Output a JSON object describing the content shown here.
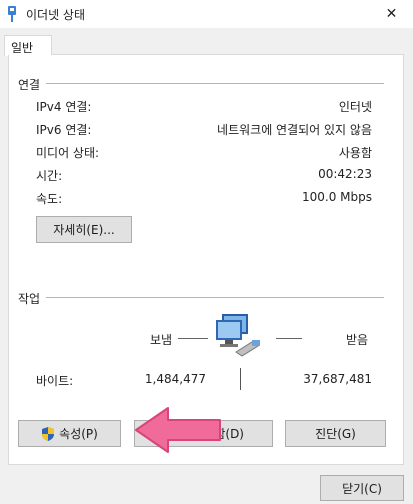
{
  "window": {
    "title": "이더넷 상태",
    "close_glyph": "✕"
  },
  "tabs": [
    {
      "label": "일반"
    }
  ],
  "connection": {
    "heading": "연결",
    "rows": [
      {
        "label": "IPv4 연결:",
        "value": "인터넷"
      },
      {
        "label": "IPv6 연결:",
        "value": "네트워크에 연결되어 있지 않음"
      },
      {
        "label": "미디어 상태:",
        "value": "사용함"
      },
      {
        "label": "시간:",
        "value": "00:42:23"
      },
      {
        "label": "속도:",
        "value": "100.0 Mbps"
      }
    ],
    "details_button": "자세히(E)..."
  },
  "activity": {
    "heading": "작업",
    "sent_label": "보냄",
    "received_label": "받음",
    "bytes_label": "바이트:",
    "bytes_sent": "1,484,477",
    "bytes_received": "37,687,481"
  },
  "buttons": {
    "properties": "속성(P)",
    "disable": "함(D)",
    "diagnose": "진단(G)",
    "close": "닫기(C)"
  },
  "icons": {
    "title": "ethernet-plug-icon",
    "network": "network-computers-icon",
    "shield": "uac-shield-icon"
  },
  "colors": {
    "annotation_arrow": "#f06b9a",
    "shield_blue": "#2d63b8",
    "shield_yellow": "#f3c623"
  }
}
